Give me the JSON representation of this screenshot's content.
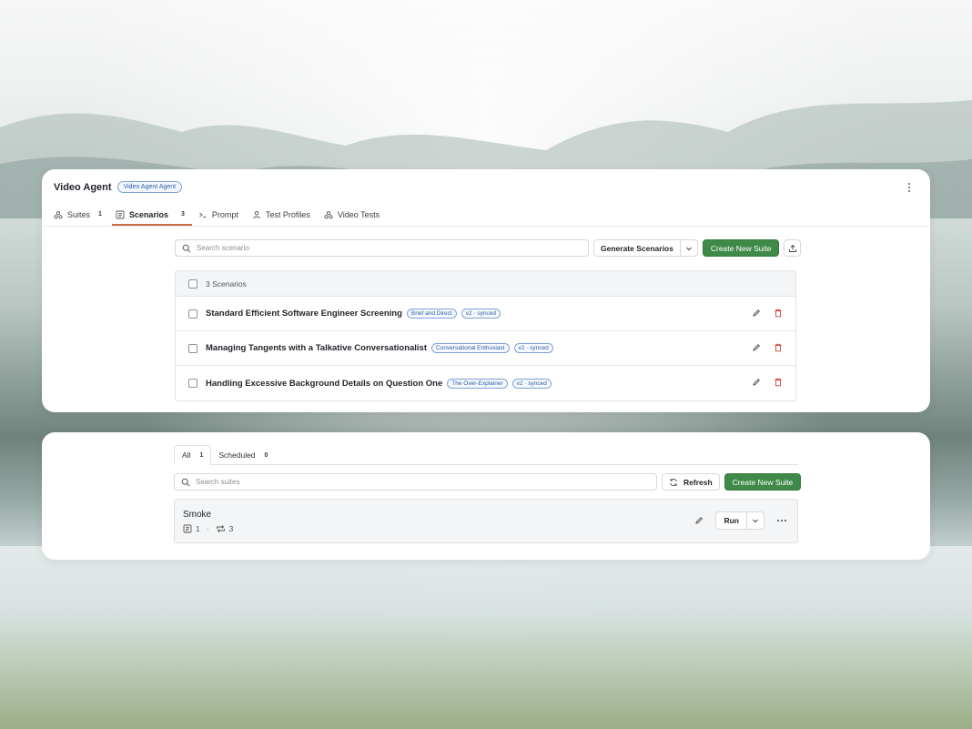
{
  "header": {
    "title": "Video Agent",
    "badge": "Video Agent Agent"
  },
  "tabs": [
    {
      "label": "Suites",
      "count": "1",
      "icon": "suites-icon"
    },
    {
      "label": "Scenarios",
      "count": "3",
      "icon": "document-icon",
      "active": true
    },
    {
      "label": "Prompt",
      "icon": "terminal-icon"
    },
    {
      "label": "Test Profiles",
      "icon": "user-icon"
    },
    {
      "label": "Video Tests",
      "icon": "suites-icon"
    }
  ],
  "scenarios_toolbar": {
    "search_placeholder": "Search scenario",
    "generate_label": "Generate Scenarios",
    "create_label": "Create New Suite"
  },
  "scenarios_table": {
    "header": "3 Scenarios",
    "rows": [
      {
        "title": "Standard Efficient Software Engineer Screening",
        "profile": "Brief and Direct",
        "version": "v2 · synced"
      },
      {
        "title": "Managing Tangents with a Talkative Conversationalist",
        "profile": "Conversational Enthusiast",
        "version": "v2 · synced"
      },
      {
        "title": "Handling Excessive Background Details on Question One",
        "profile": "The Over-Explainer",
        "version": "v2 · synced"
      }
    ]
  },
  "suites_tabs": [
    {
      "label": "All",
      "count": "1",
      "active": true
    },
    {
      "label": "Scheduled",
      "count": "0"
    }
  ],
  "suites_toolbar": {
    "search_placeholder": "Search suites",
    "refresh_label": "Refresh",
    "create_label": "Create New Suite"
  },
  "suite": {
    "name": "Smoke",
    "scenario_count": "1",
    "separator": "·",
    "run_count": "3",
    "run_label": "Run"
  },
  "colors": {
    "accent_tab": "#c96a4a",
    "primary_button": "#3f8a49",
    "badge_blue": "#2f5fa8",
    "delete_red": "#d0413a"
  }
}
